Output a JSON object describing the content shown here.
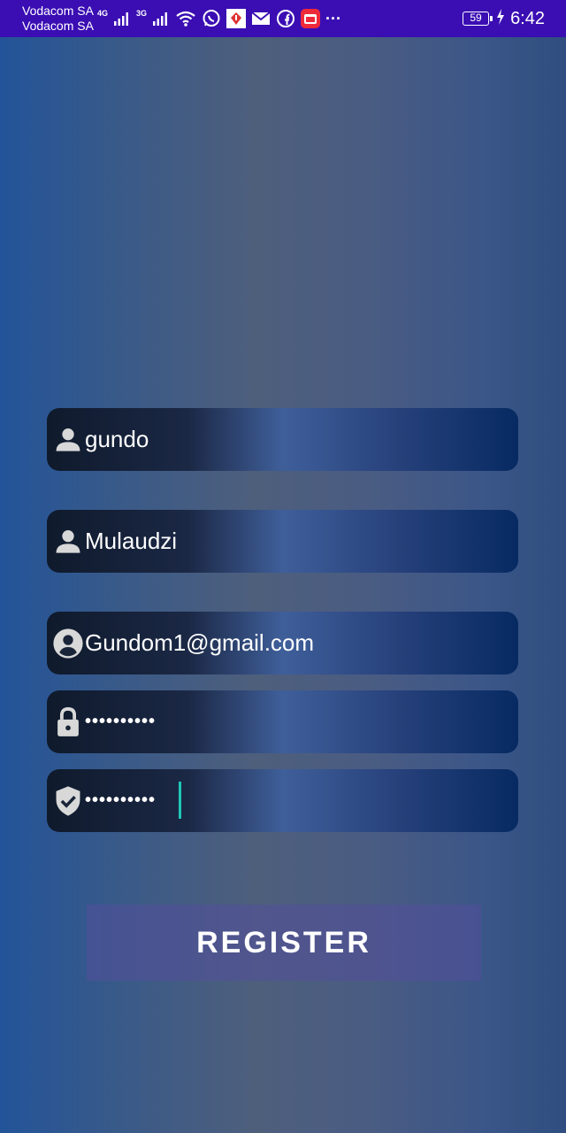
{
  "status_bar": {
    "carrier_1": "Vodacom SA",
    "carrier_2": "Vodacom SA",
    "network_1": "4G",
    "network_2": "3G",
    "battery": "59",
    "time": "6:42",
    "more": "···",
    "icons": [
      "signal-icon",
      "wifi-icon",
      "whatsapp-icon",
      "app-notification-icon",
      "mail-icon",
      "facebook-icon",
      "youtube-icon",
      "charging-icon"
    ]
  },
  "form": {
    "first_name": {
      "value": "gundo",
      "icon": "person-icon"
    },
    "last_name": {
      "value": "Mulaudzi",
      "icon": "person-icon"
    },
    "email": {
      "value": "Gundom1@gmail.com",
      "icon": "account-circle-icon"
    },
    "password": {
      "value": "••••••••••",
      "icon": "lock-icon"
    },
    "confirm_password": {
      "value": "••••••••••",
      "icon": "verified-shield-icon"
    }
  },
  "register_button": {
    "label": "REGISTER"
  },
  "colors": {
    "status_bar": "#3a0eb3",
    "cursor": "#1fc7b6",
    "icon": "#d8d8d8"
  }
}
